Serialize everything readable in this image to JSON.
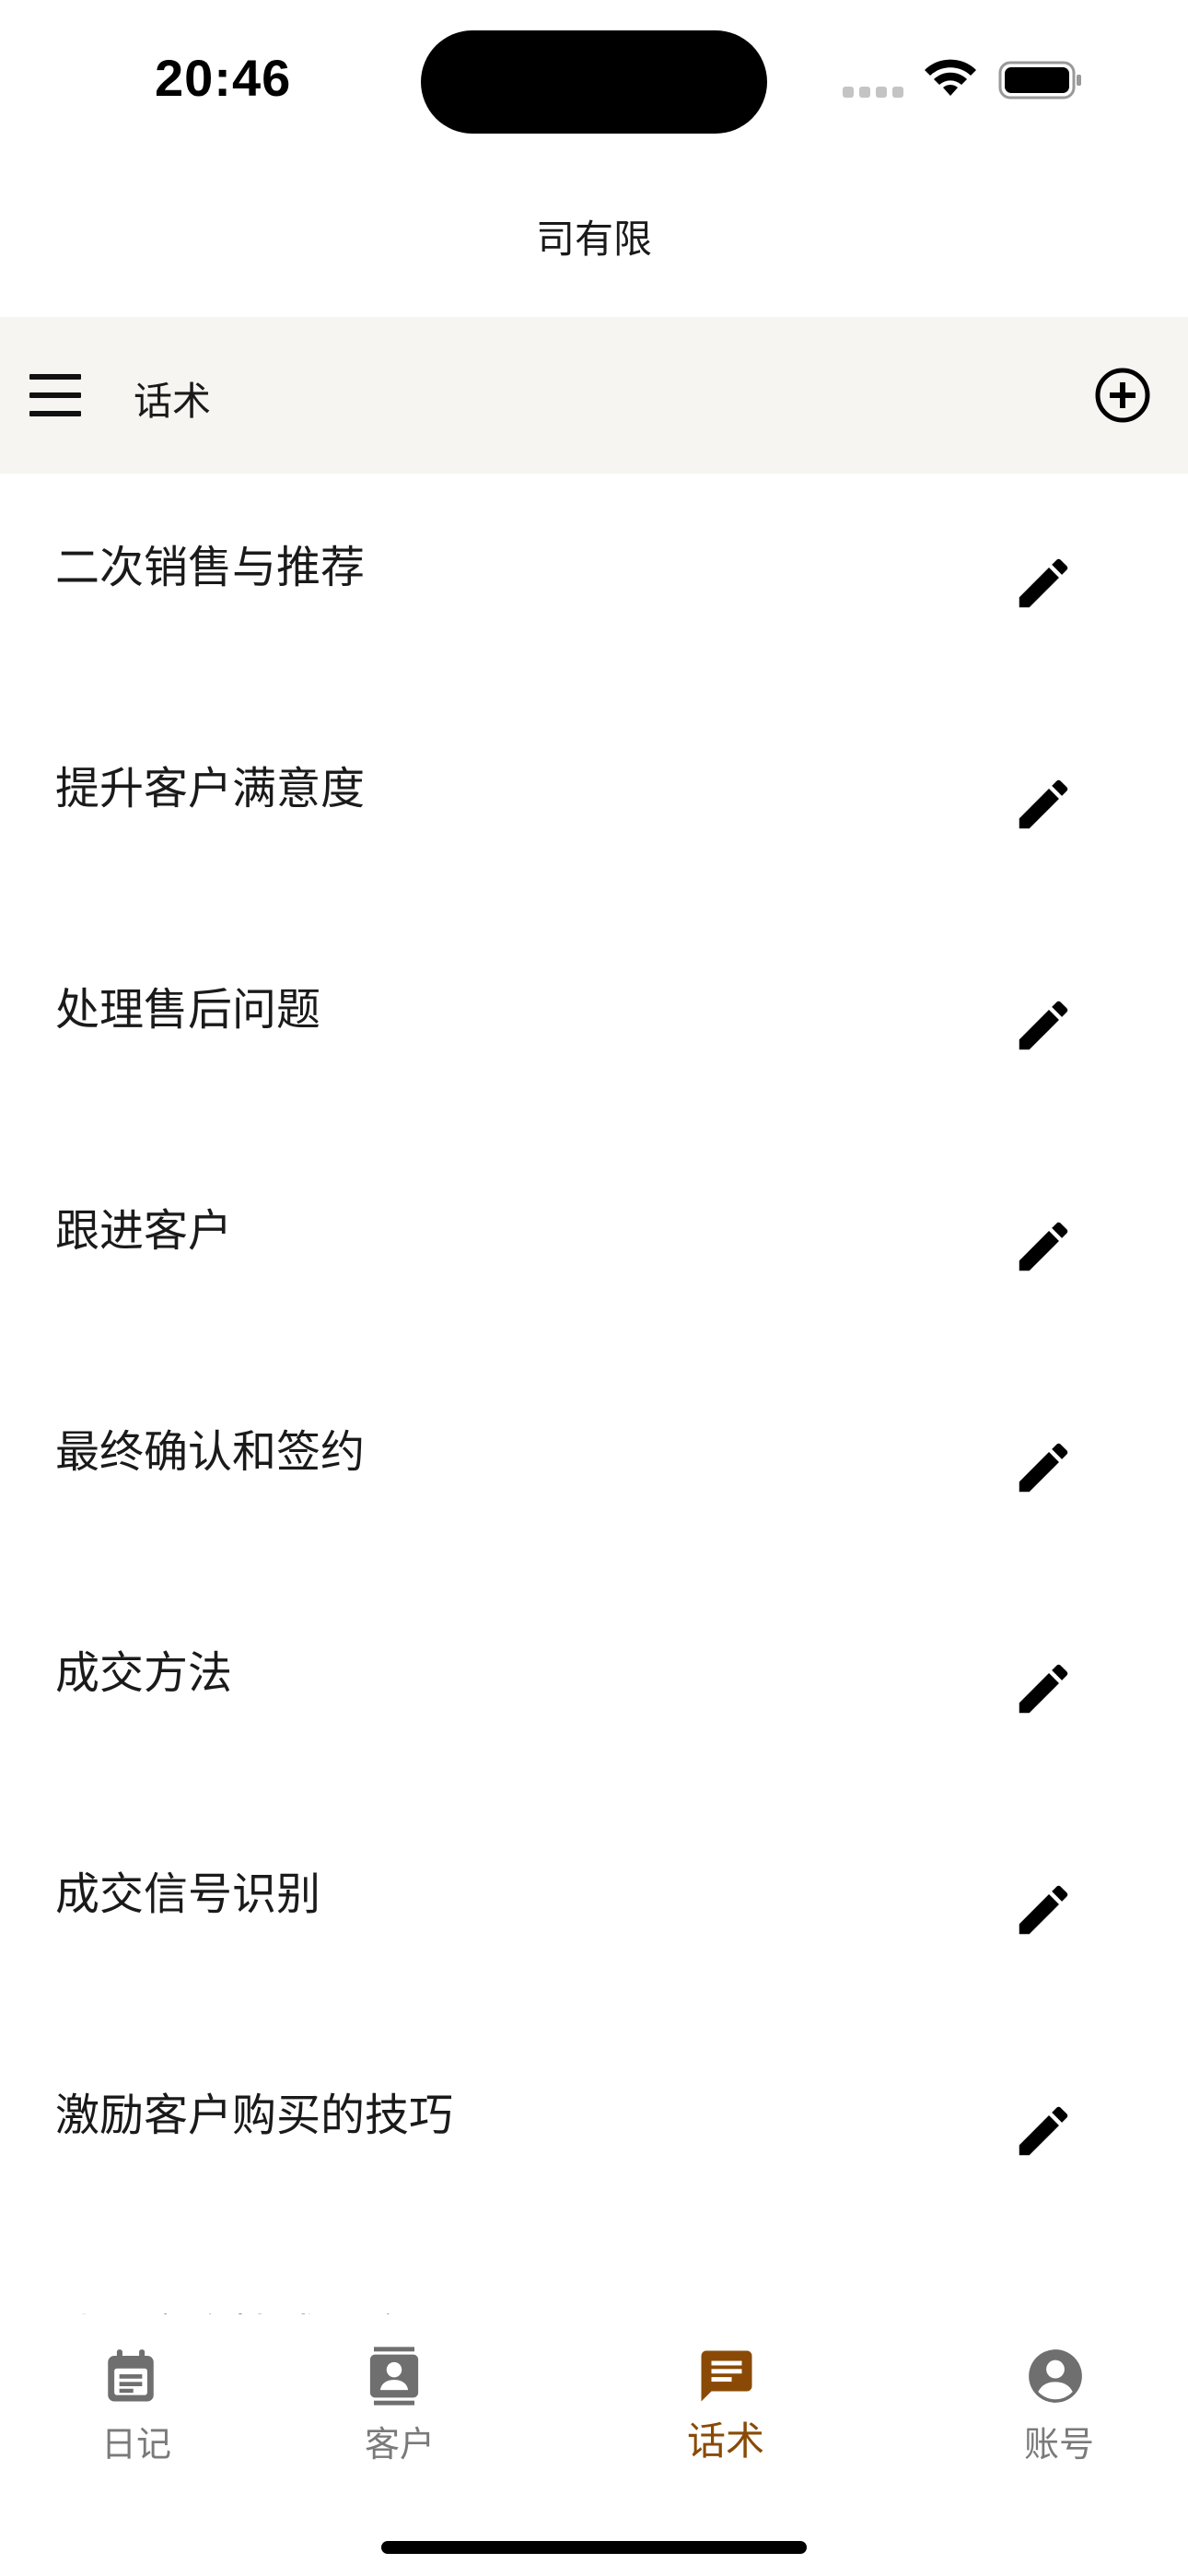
{
  "status_bar": {
    "time": "20:46"
  },
  "app_title": "司有限",
  "toolbar": {
    "title": "话术",
    "menu_icon": "hamburger-menu-icon",
    "add_icon": "add-circle-icon"
  },
  "scripts_list": [
    {
      "label": "二次销售与推荐"
    },
    {
      "label": "提升客户满意度"
    },
    {
      "label": "处理售后问题"
    },
    {
      "label": "跟进客户"
    },
    {
      "label": "最终确认和签约"
    },
    {
      "label": "成交方法"
    },
    {
      "label": "成交信号识别"
    },
    {
      "label": "激励客户购买的技巧"
    },
    {
      "label": "处理客户情感反应"
    }
  ],
  "bottom_nav": {
    "items": [
      {
        "label": "日记",
        "icon": "calendar-note-icon",
        "active": false
      },
      {
        "label": "客户",
        "icon": "contacts-icon",
        "active": false
      },
      {
        "label": "话术",
        "icon": "chat-message-icon",
        "active": true
      },
      {
        "label": "账号",
        "icon": "account-circle-icon",
        "active": false
      }
    ]
  },
  "colors": {
    "toolbar_bg": "#f7f5f1",
    "active_nav": "#8a4a05",
    "inactive_nav": "#7a7a7a"
  }
}
